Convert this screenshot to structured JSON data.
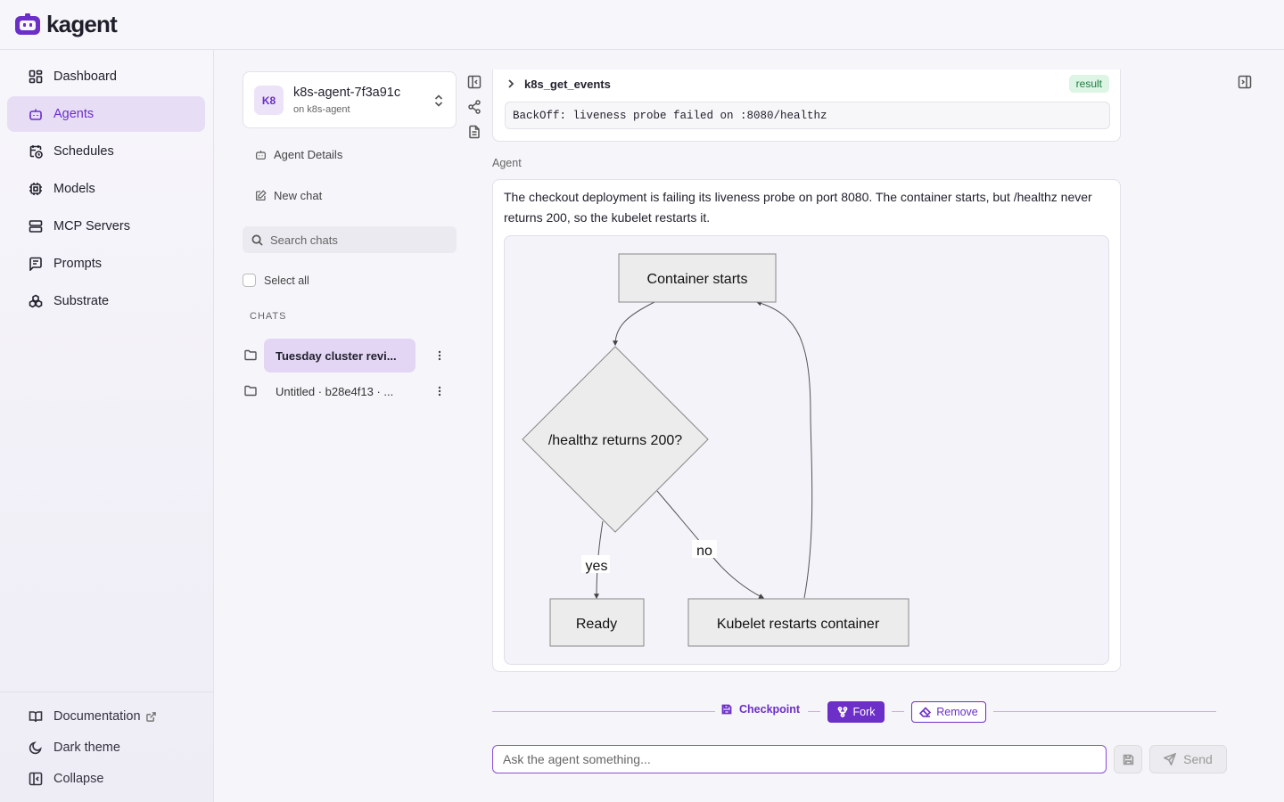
{
  "brand": {
    "name": "kagent"
  },
  "sidebar": {
    "items": [
      {
        "label": "Dashboard",
        "icon": "dashboard-icon"
      },
      {
        "label": "Agents",
        "icon": "bot-icon",
        "active": true
      },
      {
        "label": "Schedules",
        "icon": "calendar-clock-icon"
      },
      {
        "label": "Models",
        "icon": "cpu-icon"
      },
      {
        "label": "MCP Servers",
        "icon": "server-icon"
      },
      {
        "label": "Prompts",
        "icon": "message-square-text-icon"
      },
      {
        "label": "Substrate",
        "icon": "boxes-icon"
      }
    ],
    "bottom": {
      "documentation": "Documentation",
      "theme": "Dark theme",
      "collapse": "Collapse"
    }
  },
  "agent": {
    "avatar": "K8",
    "name": "k8s-agent-7f3a91c",
    "subtitle": "on k8s-agent"
  },
  "chat_panel": {
    "agent_details": "Agent Details",
    "new_chat": "New chat",
    "search_placeholder": "Search chats",
    "select_all": "Select all",
    "chats_heading": "CHATS",
    "chats": [
      {
        "title": "Tuesday cluster revi...",
        "active": true
      },
      {
        "title": "Untitled · b28e4f13 · ...",
        "active": false
      }
    ]
  },
  "tool_call": {
    "name": "k8s_get_events",
    "badge": "result",
    "output": "BackOff: liveness probe failed on :8080/healthz"
  },
  "message": {
    "role": "Agent",
    "text": "The checkout deployment is failing its liveness probe on port 8080. The container starts, but /healthz never returns 200, so the kubelet restarts it."
  },
  "diagram": {
    "nodes": {
      "start": "Container starts",
      "decision": "/healthz returns 200?",
      "ready": "Ready",
      "restart": "Kubelet restarts container"
    },
    "edges": {
      "yes": "yes",
      "no": "no"
    }
  },
  "checkpoint": {
    "label": "Checkpoint",
    "fork": "Fork",
    "remove": "Remove"
  },
  "composer": {
    "placeholder": "Ask the agent something...",
    "send": "Send"
  },
  "colors": {
    "accent": "#6c2fc7",
    "active_bg": "#e7def6",
    "badge_bg": "#dcf5e5",
    "badge_text": "#1d7a3e"
  }
}
